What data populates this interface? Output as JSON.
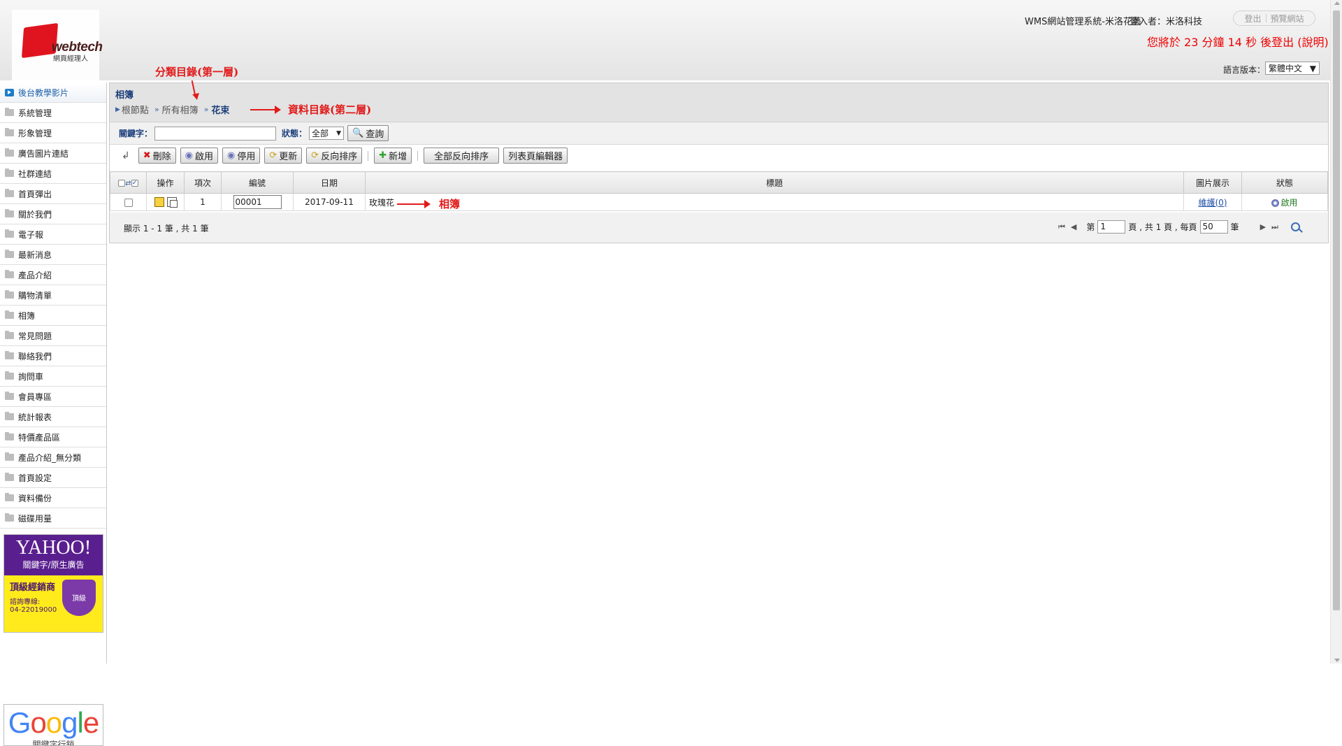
{
  "header": {
    "logo_text": "webtech",
    "logo_sub": "網頁經理人",
    "system_title": "WMS網站管理系統-米洛花藝",
    "user_label": "登入者：米洛科技",
    "logout_btn": "登出",
    "preview_btn": "預覽網站",
    "logout_timer": "您將於 23 分鐘 14 秒 後登出 (說明)",
    "lang_label": "語言版本：",
    "lang_value": "繁體中文"
  },
  "sidebar": {
    "items": [
      {
        "label": "後台教學影片"
      },
      {
        "label": "系統管理"
      },
      {
        "label": "形象管理"
      },
      {
        "label": "廣告圖片連結"
      },
      {
        "label": "社群連結"
      },
      {
        "label": "首頁彈出"
      },
      {
        "label": "關於我們"
      },
      {
        "label": "電子報"
      },
      {
        "label": "最新消息"
      },
      {
        "label": "產品介紹"
      },
      {
        "label": "購物清單"
      },
      {
        "label": "相簿"
      },
      {
        "label": "常見問題"
      },
      {
        "label": "聯絡我們"
      },
      {
        "label": "詢問車"
      },
      {
        "label": "會員專區"
      },
      {
        "label": "統計報表"
      },
      {
        "label": "特價產品區"
      },
      {
        "label": "產品介紹_無分類"
      },
      {
        "label": "首頁設定"
      },
      {
        "label": "資料備份"
      },
      {
        "label": "磁碟用量"
      }
    ],
    "ad_yahoo": {
      "brand": "YAHOO!",
      "sub": "關鍵字/原生廣告",
      "dealer": "頂級經銷商",
      "hotline": "諮詢專線:",
      "phone": "04-22019000",
      "badge": "頂級"
    },
    "ad_google": {
      "brand": "Google",
      "sub": "關鍵字行銷"
    }
  },
  "content": {
    "page_title": "相簿",
    "breadcrumb": [
      "根節點",
      "所有相簿",
      "花束"
    ],
    "search": {
      "keyword_label": "關鍵字：",
      "status_label": "狀態：",
      "status_value": "全部",
      "query_btn": "查詢"
    },
    "toolbar": {
      "back": "↲",
      "delete": "刪除",
      "enable": "啟用",
      "disable": "停用",
      "update": "更新",
      "reverse": "反向排序",
      "add": "新增",
      "reverse_all": "全部反向排序",
      "list_editor": "列表頁編輯器"
    },
    "table": {
      "headers": [
        "操作",
        "項次",
        "編號",
        "日期",
        "標題",
        "圖片展示",
        "狀態"
      ],
      "rows": [
        {
          "index": "1",
          "code": "00001",
          "date": "2017-09-11",
          "title": "玫瑰花",
          "gallery": "維護(0)",
          "status": "啟用"
        }
      ]
    },
    "footer": {
      "record_count": "顯示 1 - 1 筆 , 共 1 筆",
      "page_prefix": "第",
      "page_value": "1",
      "page_mid": "頁 , 共 1 頁 , 每頁",
      "per_page": "50",
      "page_suffix": "筆"
    }
  },
  "annotations": {
    "category_dir": "分類目錄(第一層)",
    "data_dir": "資料目錄(第二層)",
    "album": "相簿"
  },
  "colors": {
    "accent": "#1d3f7c",
    "timer": "#e00000",
    "annotation": "#e21b1b"
  }
}
